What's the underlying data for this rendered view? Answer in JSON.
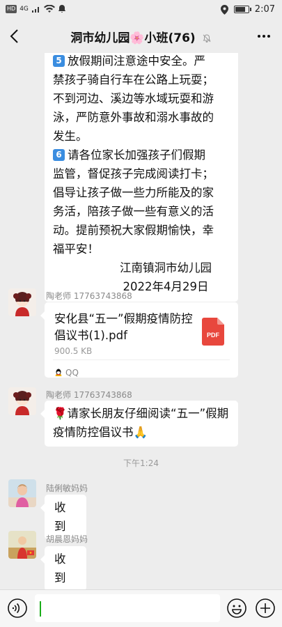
{
  "status_bar": {
    "hd": "HD",
    "signal": "4G",
    "time": "2:07",
    "battery_level": 0.8
  },
  "header": {
    "title": "洞市幼儿园🌸小班(76)"
  },
  "messages": {
    "long": {
      "lines": [
        "放假期间注意途中安全。严",
        "禁孩子骑自行车在公路上玩耍；",
        "不到河边、溪边等水域玩耍和游",
        "泳，严防意外事故和溺水事故的",
        "发生。",
        "请各位家长加强孩子们假期",
        "监管，督促孩子完成阅读打卡；",
        "倡导让孩子做一些力所能及的家",
        "务活，陪孩子做一些有意义的活",
        "动。提前预祝大家假期愉快，幸",
        "福平安！"
      ],
      "keycap_5": "5",
      "keycap_6": "6",
      "signature": "江南镇洞市幼儿园",
      "date": "2022年4月29日"
    },
    "file": {
      "sender": "陶老师 17763743868",
      "name": "安化县“五一”假期疫情防控倡议书(1).pdf",
      "size": "900.5 KB",
      "icon_label": "PDF",
      "source": "QQ"
    },
    "notice": {
      "sender": "陶老师 17763743868",
      "text": "🌹请家长朋友仔细阅读“五一”假期疫情防控倡议书🙏"
    },
    "timestamp": "下午1:24",
    "reply1": {
      "sender": "陆俐敏妈妈",
      "text": "收到"
    },
    "reply2": {
      "sender": "胡晨恩妈妈",
      "text": "收到"
    }
  },
  "input": {
    "value": ""
  }
}
